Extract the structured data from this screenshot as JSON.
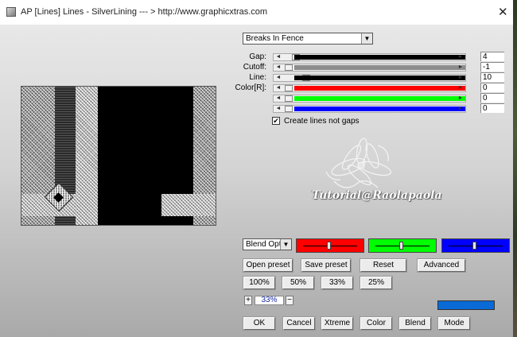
{
  "window": {
    "title": "AP [Lines]  Lines - SilverLining    --- > http://www.graphicxtras.com",
    "close_symbol": "✕"
  },
  "effect_select": {
    "value": "Breaks In Fence"
  },
  "sliders": [
    {
      "label": "Gap:",
      "value": "4",
      "level": 0.04,
      "color": "#000000"
    },
    {
      "label": "Cutoff:",
      "value": "-1",
      "level": 0.0,
      "color": "#8c8c8c"
    },
    {
      "label": "Line:",
      "value": "10",
      "level": 0.1,
      "color": "#000000"
    },
    {
      "label": "Color[R]:",
      "value": "0",
      "level": 0.0,
      "color": "#ff0000"
    },
    {
      "label": "",
      "value": "0",
      "level": 0.0,
      "color": "#00ff00"
    },
    {
      "label": "",
      "value": "0",
      "level": 0.0,
      "color": "#0000ff"
    }
  ],
  "checkbox": {
    "label": "Create lines not gaps",
    "checked": true,
    "mark": "✔"
  },
  "watermark": {
    "text": "Tutorial@Raolapaola"
  },
  "blend_select": {
    "value": "Blend Options"
  },
  "color_bars": [
    {
      "color": "#ff0000",
      "level": 0.5
    },
    {
      "color": "#00ff00",
      "level": 0.5
    },
    {
      "color": "#0000ff",
      "level": 0.5
    }
  ],
  "preset_buttons": {
    "open": "Open preset",
    "save": "Save preset",
    "reset": "Reset",
    "advanced": "Advanced"
  },
  "zoom_buttons": [
    "100%",
    "50%",
    "33%",
    "25%"
  ],
  "zoom": {
    "plus": "+",
    "value": "33%",
    "minus": "−"
  },
  "swatch_color": "#0a6ad6",
  "bottom_buttons": {
    "ok": "OK",
    "cancel": "Cancel",
    "xtreme": "Xtreme",
    "color": "Color",
    "blend": "Blend",
    "mode": "Mode"
  }
}
